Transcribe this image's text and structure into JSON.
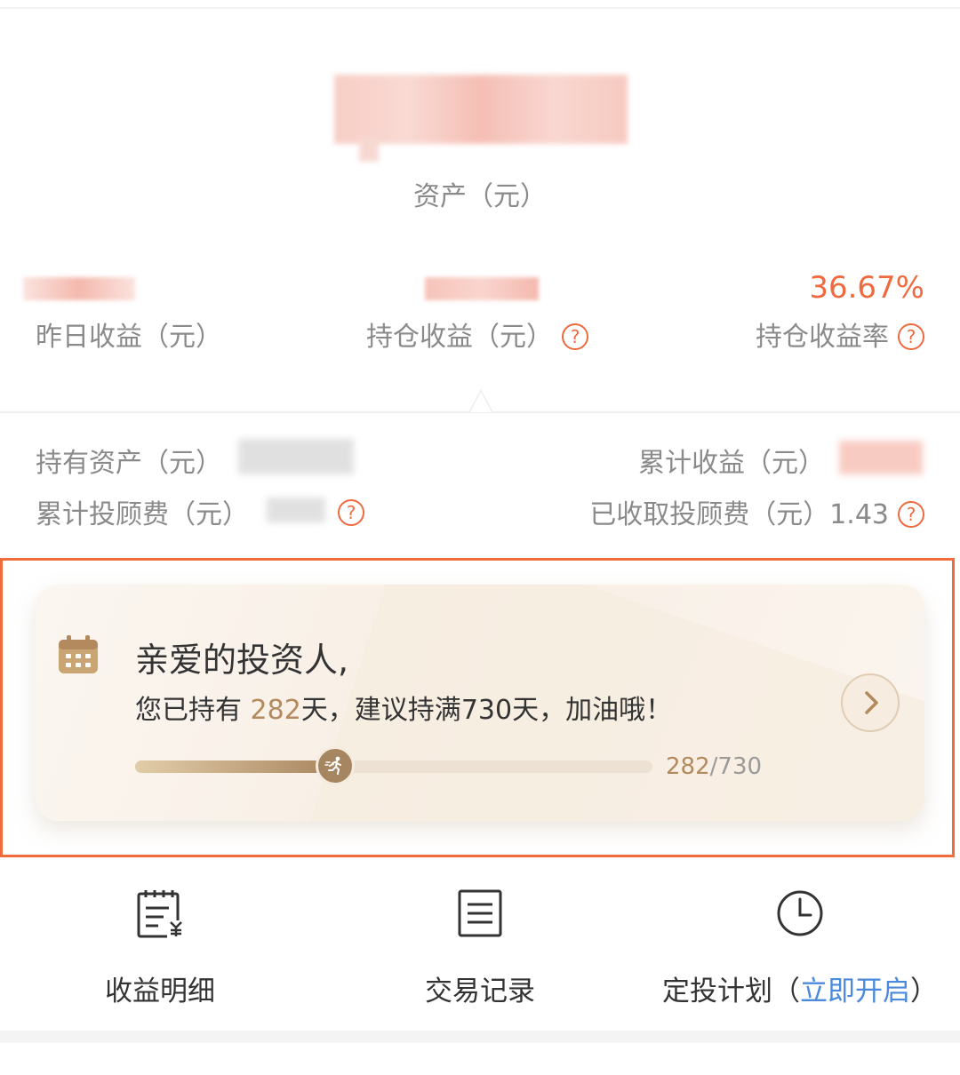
{
  "header": {
    "asset_label": "资产（元）"
  },
  "stats": {
    "yesterday_label": "昨日收益（元）",
    "holding_label": "持仓收益（元）",
    "rate_value": "36.67%",
    "rate_label": "持仓收益率",
    "help_glyph": "?"
  },
  "details": {
    "held_assets_label": "持有资产（元）",
    "cumulative_income_label": "累计收益（元）",
    "cumulative_fee_label": "累计投顾费（元）",
    "collected_fee_label": "已收取投顾费（元）",
    "collected_fee_value": "1.43"
  },
  "card": {
    "title": "亲爱的投资人,",
    "sub_prefix": "您已持有",
    "held_days": "282",
    "sub_mid": "天，建议持满",
    "target_days": "730",
    "sub_suffix": "天，加油哦！",
    "progress_current": "282",
    "progress_total": "/730",
    "progress_fraction": 0.386
  },
  "nav": {
    "income_detail": "收益明细",
    "transactions": "交易记录",
    "plan_prefix": "定投计划（",
    "plan_link": "立即开启",
    "plan_suffix": "）"
  },
  "colors": {
    "accent": "#f06a3f",
    "gold": "#b38a5d",
    "link": "#4a89dc"
  }
}
